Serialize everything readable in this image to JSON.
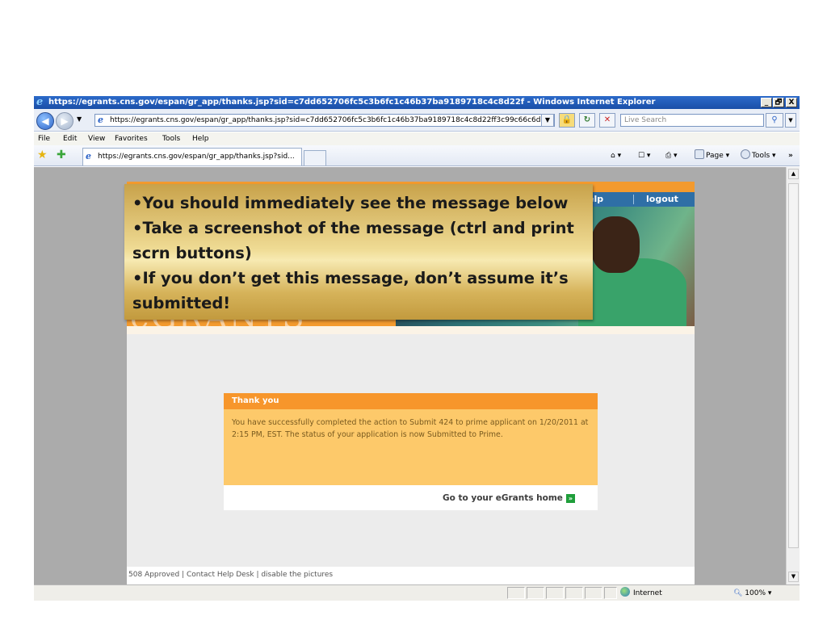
{
  "window": {
    "title": "https://egrants.cns.gov/espan/gr_app/thanks.jsp?sid=c7dd652706fc5c3b6fc1c46b37ba9189718c4c8d22f - Windows Internet Explorer",
    "controls": {
      "minimize": "_",
      "maximize": "🗗",
      "close": "X"
    }
  },
  "address_bar": {
    "url": "https://egrants.cns.gov/espan/gr_app/thanks.jsp?sid=c7dd652706fc5c3b6fc1c46b37ba9189718c4c8d22ff3c99c66c6d",
    "search_placeholder": "Live Search"
  },
  "menu": [
    "File",
    "Edit",
    "View",
    "Favorites",
    "Tools",
    "Help"
  ],
  "tab": {
    "label": "https://egrants.cns.gov/espan/gr_app/thanks.jsp?sid..."
  },
  "command_bar": {
    "page": "Page",
    "tools": "Tools"
  },
  "status_bar": {
    "zone": "Internet",
    "zoom": "100%"
  },
  "site": {
    "nav": {
      "help": "elp",
      "logout": "logout"
    },
    "logo": "eGRANTS"
  },
  "thank_you": {
    "header": "Thank you",
    "message": "You have successfully completed the action to Submit 424 to prime applicant on 1/20/2011 at 2:15 PM, EST. The status of your application is now Submitted to Prime.",
    "home_link": "Go to your eGrants home"
  },
  "footer": {
    "text": "508 Approved  | Contact Help Desk  | disable the pictures"
  },
  "callout": {
    "lines": [
      "•You should immediately see the message below",
      "•Take a screenshot of the message (ctrl and print scrn buttons)",
      "•If you don’t get this message, don’t assume it’s submitted!"
    ]
  },
  "colors": {
    "title_bar": "#1a4fa8",
    "banner_orange": "#f39a2e",
    "thank_you_header": "#f7962b",
    "thank_you_body": "#fdc96a",
    "callout_gold": "#d6b35a",
    "nav_blue": "#2f6fa6"
  }
}
